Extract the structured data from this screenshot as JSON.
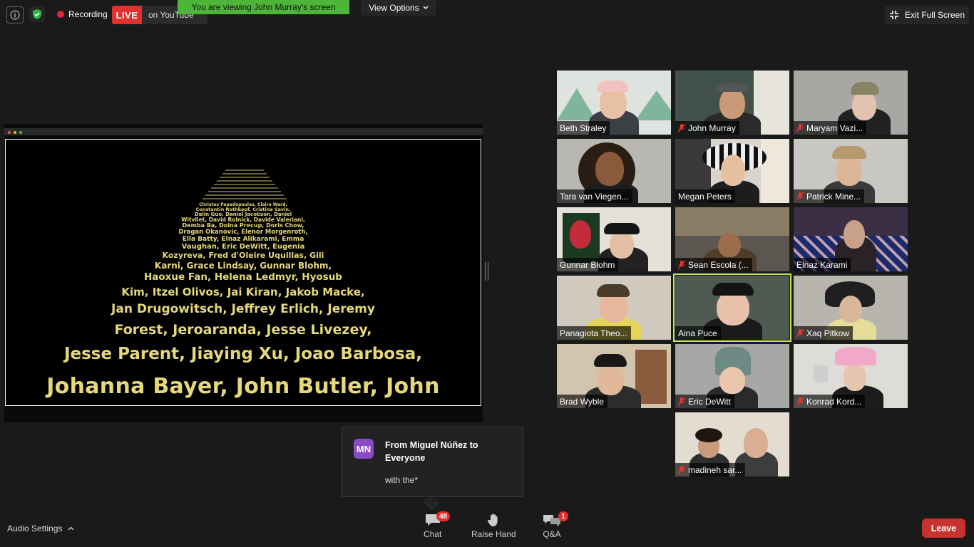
{
  "topbar": {
    "recording_label": "Recording",
    "live_label": "LIVE",
    "live_platform": "on YouTube",
    "viewing_banner": "You are viewing John Murray's screen",
    "view_options": "View Options",
    "exit_fullscreen": "Exit Full Screen"
  },
  "shared_screen": {
    "crawl_lines": [
      "Johanna Bayer, John Butler, John",
      "Jesse Parent, Jiaying Xu, Joao Barbosa,",
      "Forest, Jeroaranda, Jesse Livezey,",
      "Jan Drugowitsch, Jeffrey Erlich, Jeremy",
      "Kim, Itzel Olivos, Jai Kiran, Jakob Macke,",
      "Haoxue Fan, Helena Ledmyr, Hyosub",
      "Karni, Grace Lindsay, Gunnar Blohm,",
      "Kozyreva, Fred d'Oleire Uquillas, Gili",
      "Vaughan, Eric DeWitt, Eugenia",
      "Ella Batty, Elnaz Alikarami, Emma",
      "Dragan Okanovic, Elenor Morgenroth,",
      "Demba Ba, Doina Precup, Doris Chow,",
      "Witvliet, David Rolnick, Davide Valeriani,",
      "Dalin Guo, Daniel Jacobson, Daniel",
      "Constantin Rothkopf, Cristina Savin,",
      "Christos Papadopoulos, Claire Ward,"
    ]
  },
  "participants": [
    {
      "name": "Beth Straley",
      "muted": false
    },
    {
      "name": "John Murray",
      "muted": true
    },
    {
      "name": "Maryam Vazi...",
      "muted": true
    },
    {
      "name": "Tara van Viegen...",
      "muted": false
    },
    {
      "name": "Megan Peters",
      "muted": false
    },
    {
      "name": "Patrick Mine...",
      "muted": true
    },
    {
      "name": "Gunnar Blohm",
      "muted": false
    },
    {
      "name": "Sean Escola (...",
      "muted": true
    },
    {
      "name": "Elnaz Karami",
      "muted": false
    },
    {
      "name": "Panagiota Theo...",
      "muted": false
    },
    {
      "name": "Aina Puce",
      "muted": false
    },
    {
      "name": "Xaq Pitkow",
      "muted": true
    },
    {
      "name": "Brad Wyble",
      "muted": false
    },
    {
      "name": "Eric DeWitt",
      "muted": true
    },
    {
      "name": "Konrad Kord...",
      "muted": true
    },
    {
      "name": "madineh sar...",
      "muted": true
    }
  ],
  "chat_toast": {
    "avatar_initials": "MN",
    "from": "From Miguel Núñez to Everyone",
    "message": "with the*"
  },
  "toolbar": {
    "audio_settings": "Audio Settings",
    "chat_label": "Chat",
    "chat_badge": "48",
    "raise_hand_label": "Raise Hand",
    "qa_label": "Q&A",
    "qa_badge": "1",
    "leave_label": "Leave"
  },
  "colors": {
    "background": "#1a1a1a",
    "live_red": "#e0312f",
    "banner_green": "#4fb43a",
    "active_speaker": "#c6e85b",
    "crawl_yellow": "#e6d87a",
    "avatar_purple": "#8a4bc4",
    "leave_red": "#c8322f"
  }
}
